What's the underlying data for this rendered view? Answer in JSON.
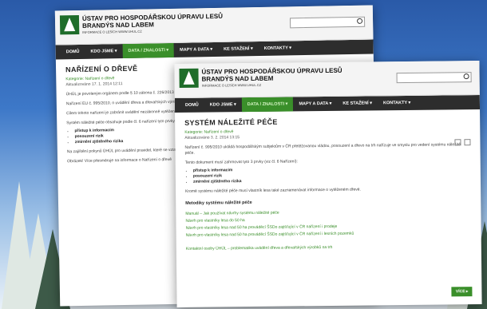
{
  "logo": {
    "line1": "ÚSTAV PRO HOSPODÁŘSKOU ÚPRAVU LESŮ",
    "line2": "BRANDÝS NAD LABEM",
    "sub": "INFORMACE O LESÍCH WWW.UHUL.CZ"
  },
  "nav": [
    "DOMŮ",
    "KDO JSME ▾",
    "DATA / ZNALOSTI ▾",
    "MAPY A DATA ▾",
    "KE STAŽENÍ ▾",
    "KONTAKTY ▾"
  ],
  "window1": {
    "title": "NAŘÍZENÍ O DŘEVĚ",
    "category": "Kategorie: Nařízení o dřevě",
    "updated": "Aktualizováno 17. 1. 2014 12:11",
    "p1": "ÚHÚL je povoleným orgánem podle § 10 zákona č. 226/2013 Sb. o uvádění dřeva a dřevařských výrobků na trh. Nařízení EU o dřevě.",
    "p2": "Nařízení EU č. 995/2010, o uvádění dřeva a dřevařských výrobků na trh.",
    "p3": "Cílem tohoto nařízení je zabránit uvádění nezákonně vytěženého dřeva na trh EU. Nařízení platí pro veškeré dřevo...",
    "p4": "Systém náležité péče obsahuje podle čl. 6 nařízení tyto prvky:",
    "b1": "přístup k informacím",
    "b2": "posouzení rizik",
    "b3": "zmírnění zjištěného rizika",
    "p5": "Na zajištění pokynů ÚHÚL pro uvádění pravidel, které se vztahují k nařízení.",
    "p6": "Obrázek! Více přesměruje na informace o Nařízení o dřevě"
  },
  "window2": {
    "title": "SYSTÉM NÁLEŽITÉ PÉČE",
    "category": "Kategorie: Nařízení o dřevě",
    "updated": "Aktualizováno 3. 2. 2014 13:15",
    "p1": "Nařízení č. 995/2010 ukládá hospodářským subjektům v ČR přetěžovanou vládou, posouzení a dřevo na trh nařízuje ve smyslu pro vedení systému náležité péče.",
    "p2": "Tento dokument musí zahrnovat tyto 3 prvky (viz čl. 6 Nařízení):",
    "b1": "přístup k informacím",
    "b2": "posouzení rizik",
    "b3": "zmírnění zjištěného rizika",
    "p3": "Kromě systému náležité péče musí vlastník lesa také zaznamenávat informace o vytěženém dřevě.",
    "section": "Metodiky systému náležité péče",
    "links": [
      "Manuál – Jak používat návrhy systému náležité péče",
      "Návrh pro vlastníky lesa do 50 ha",
      "Návrh pro vlastníky lesa nad 50 ha prováděcí ŠSDo zajišťující v ČR nařízení i prodeje",
      "Návrh pro vlastníky lesa nad 50 ha prováděcí ŠSDo zajišťující v ČR nařízení i lesních pozemků"
    ],
    "contact": "Kontaktní osoby ÚHÚL – problematika uvádění dřeva a dřevařských výrobků na trh",
    "up_button": "VÍCE ▸"
  },
  "search": {
    "placeholder": ""
  }
}
